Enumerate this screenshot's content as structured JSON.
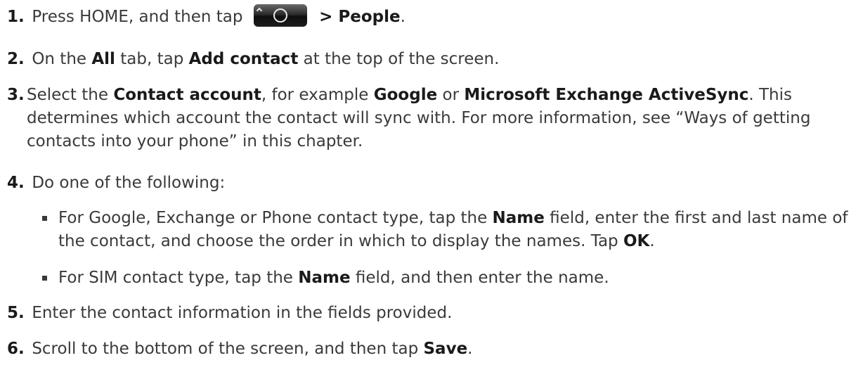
{
  "steps": [
    {
      "num": "1.",
      "parts": [
        "Press HOME, and then tap",
        "> People",
        "."
      ]
    },
    {
      "num": "2.",
      "parts": [
        "On the ",
        "All",
        " tab, tap ",
        "Add contact",
        " at the top of the screen."
      ]
    },
    {
      "num": "3.",
      "parts": [
        "Select the ",
        "Contact account",
        ", for example ",
        "Google",
        " or ",
        "Microsoft Exchange ActiveSync",
        ". This determines which account the contact will sync with. For more information, see “Ways of getting contacts into your phone” in this chapter."
      ]
    },
    {
      "num": "4.",
      "parts": [
        "Do one of the following:"
      ],
      "bullets": [
        {
          "parts": [
            "For Google, Exchange or Phone contact type, tap the ",
            "Name",
            " field, enter the first and last name of the contact, and choose the order in which to display the names. Tap ",
            "OK",
            "."
          ]
        },
        {
          "parts": [
            "For SIM contact type, tap the ",
            "Name",
            " field, and then enter the name."
          ]
        }
      ]
    },
    {
      "num": "5.",
      "parts": [
        "Enter the contact information in the fields provided."
      ]
    },
    {
      "num": "6.",
      "parts": [
        "Scroll to the bottom of the screen, and then tap ",
        "Save",
        "."
      ]
    }
  ],
  "icons": {
    "all_apps_button": "all-apps-circle-icon"
  }
}
